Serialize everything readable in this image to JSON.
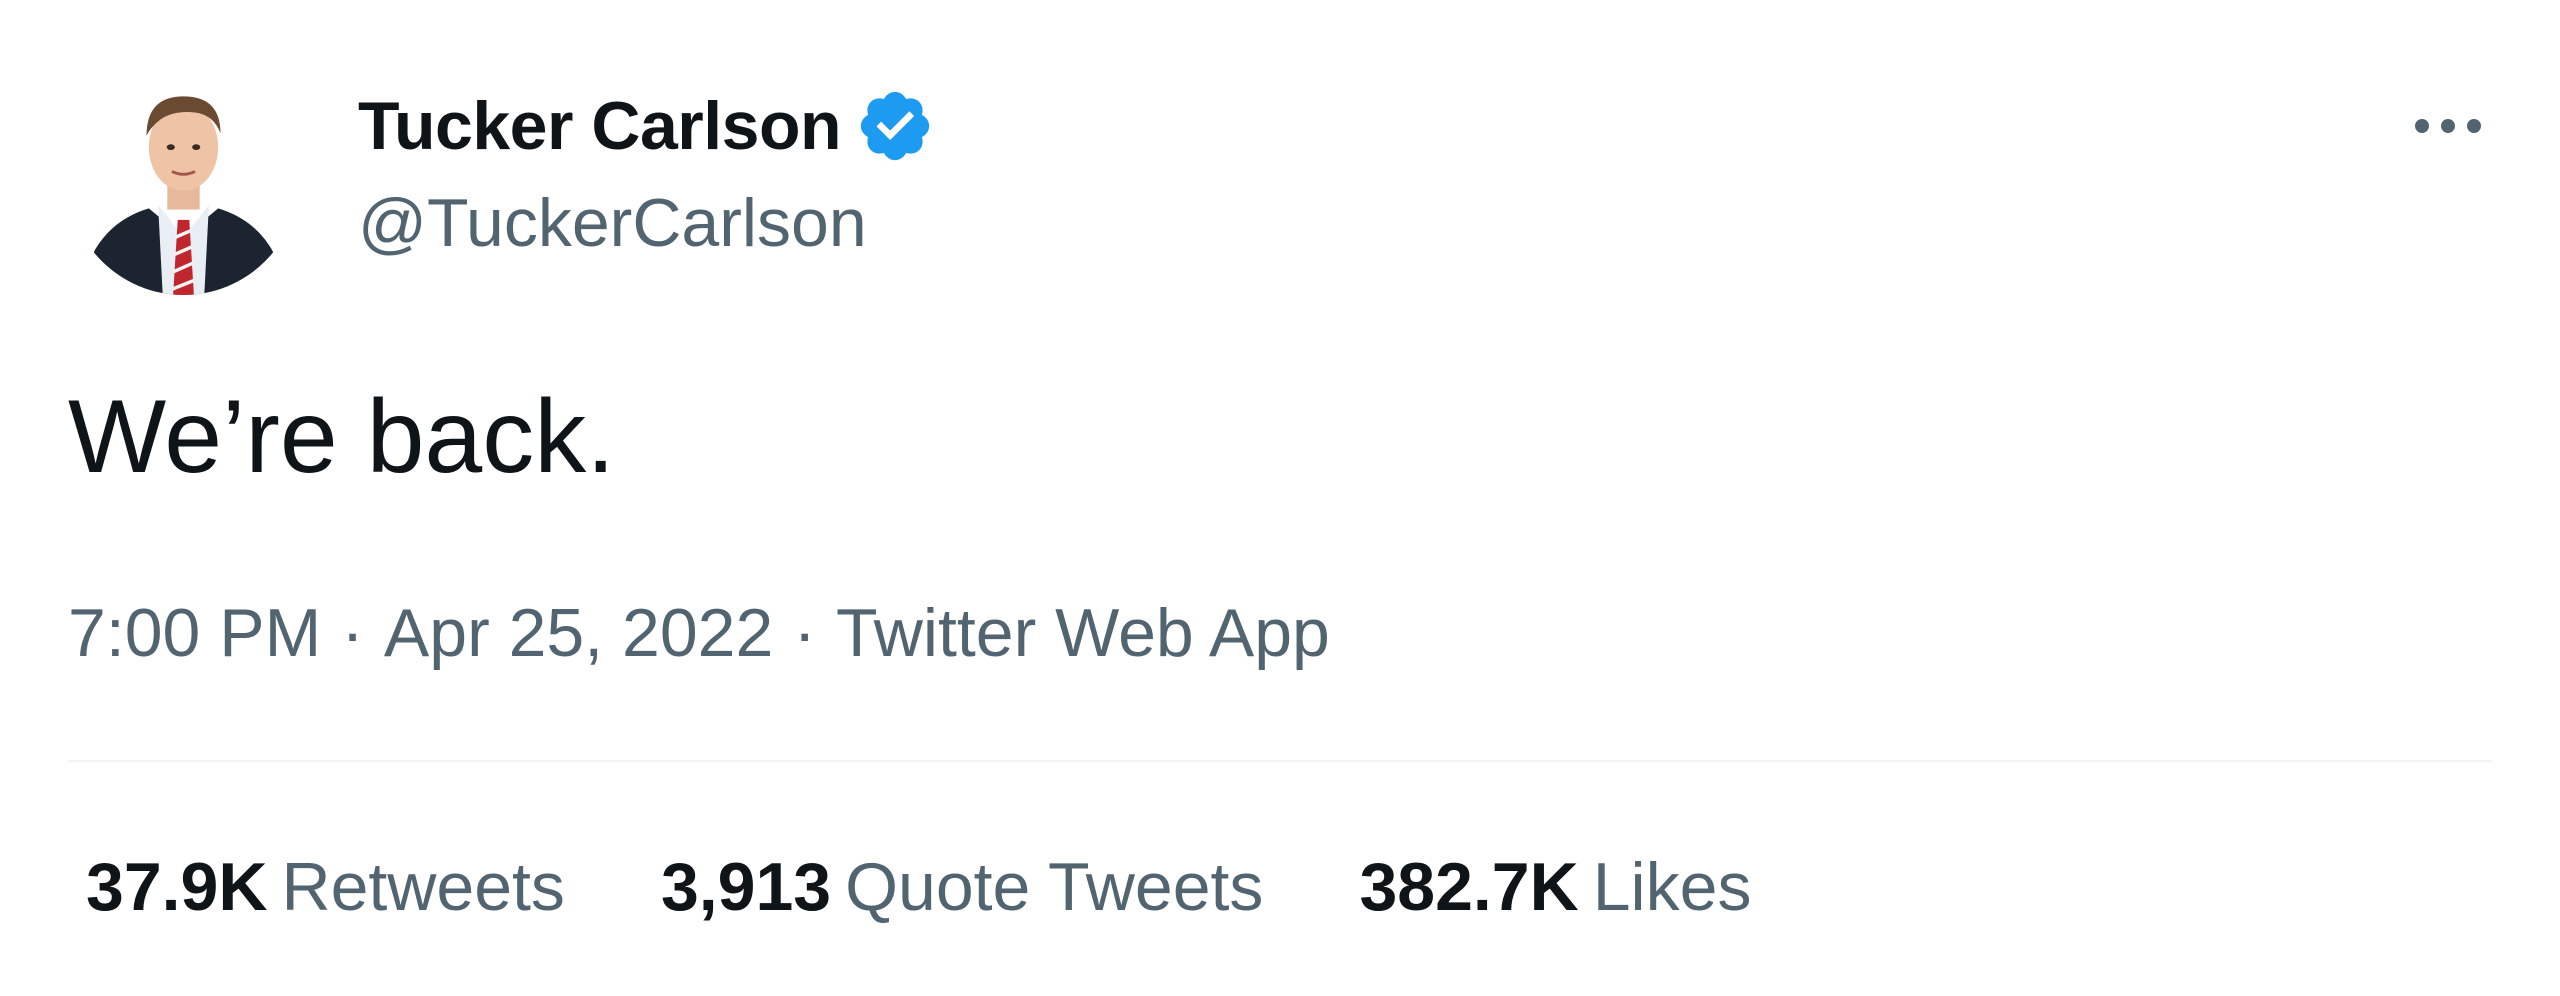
{
  "author": {
    "display_name": "Tucker Carlson",
    "handle": "@TuckerCarlson",
    "verified": true
  },
  "tweet": {
    "text": "We’re back."
  },
  "meta": {
    "time": "7:00 PM",
    "separator": "·",
    "date": "Apr 25, 2022",
    "source": "Twitter Web App"
  },
  "stats": {
    "retweets": {
      "count": "37.9K",
      "label": "Retweets"
    },
    "quotes": {
      "count": "3,913",
      "label": "Quote Tweets"
    },
    "likes": {
      "count": "382.7K",
      "label": "Likes"
    }
  },
  "icons": {
    "more": "more-horizontal-icon",
    "verified": "verified-badge-icon"
  },
  "colors": {
    "text_primary": "#0f1419",
    "text_secondary": "#536471",
    "verified_blue": "#1d9bf0",
    "divider": "#eff3f4"
  }
}
